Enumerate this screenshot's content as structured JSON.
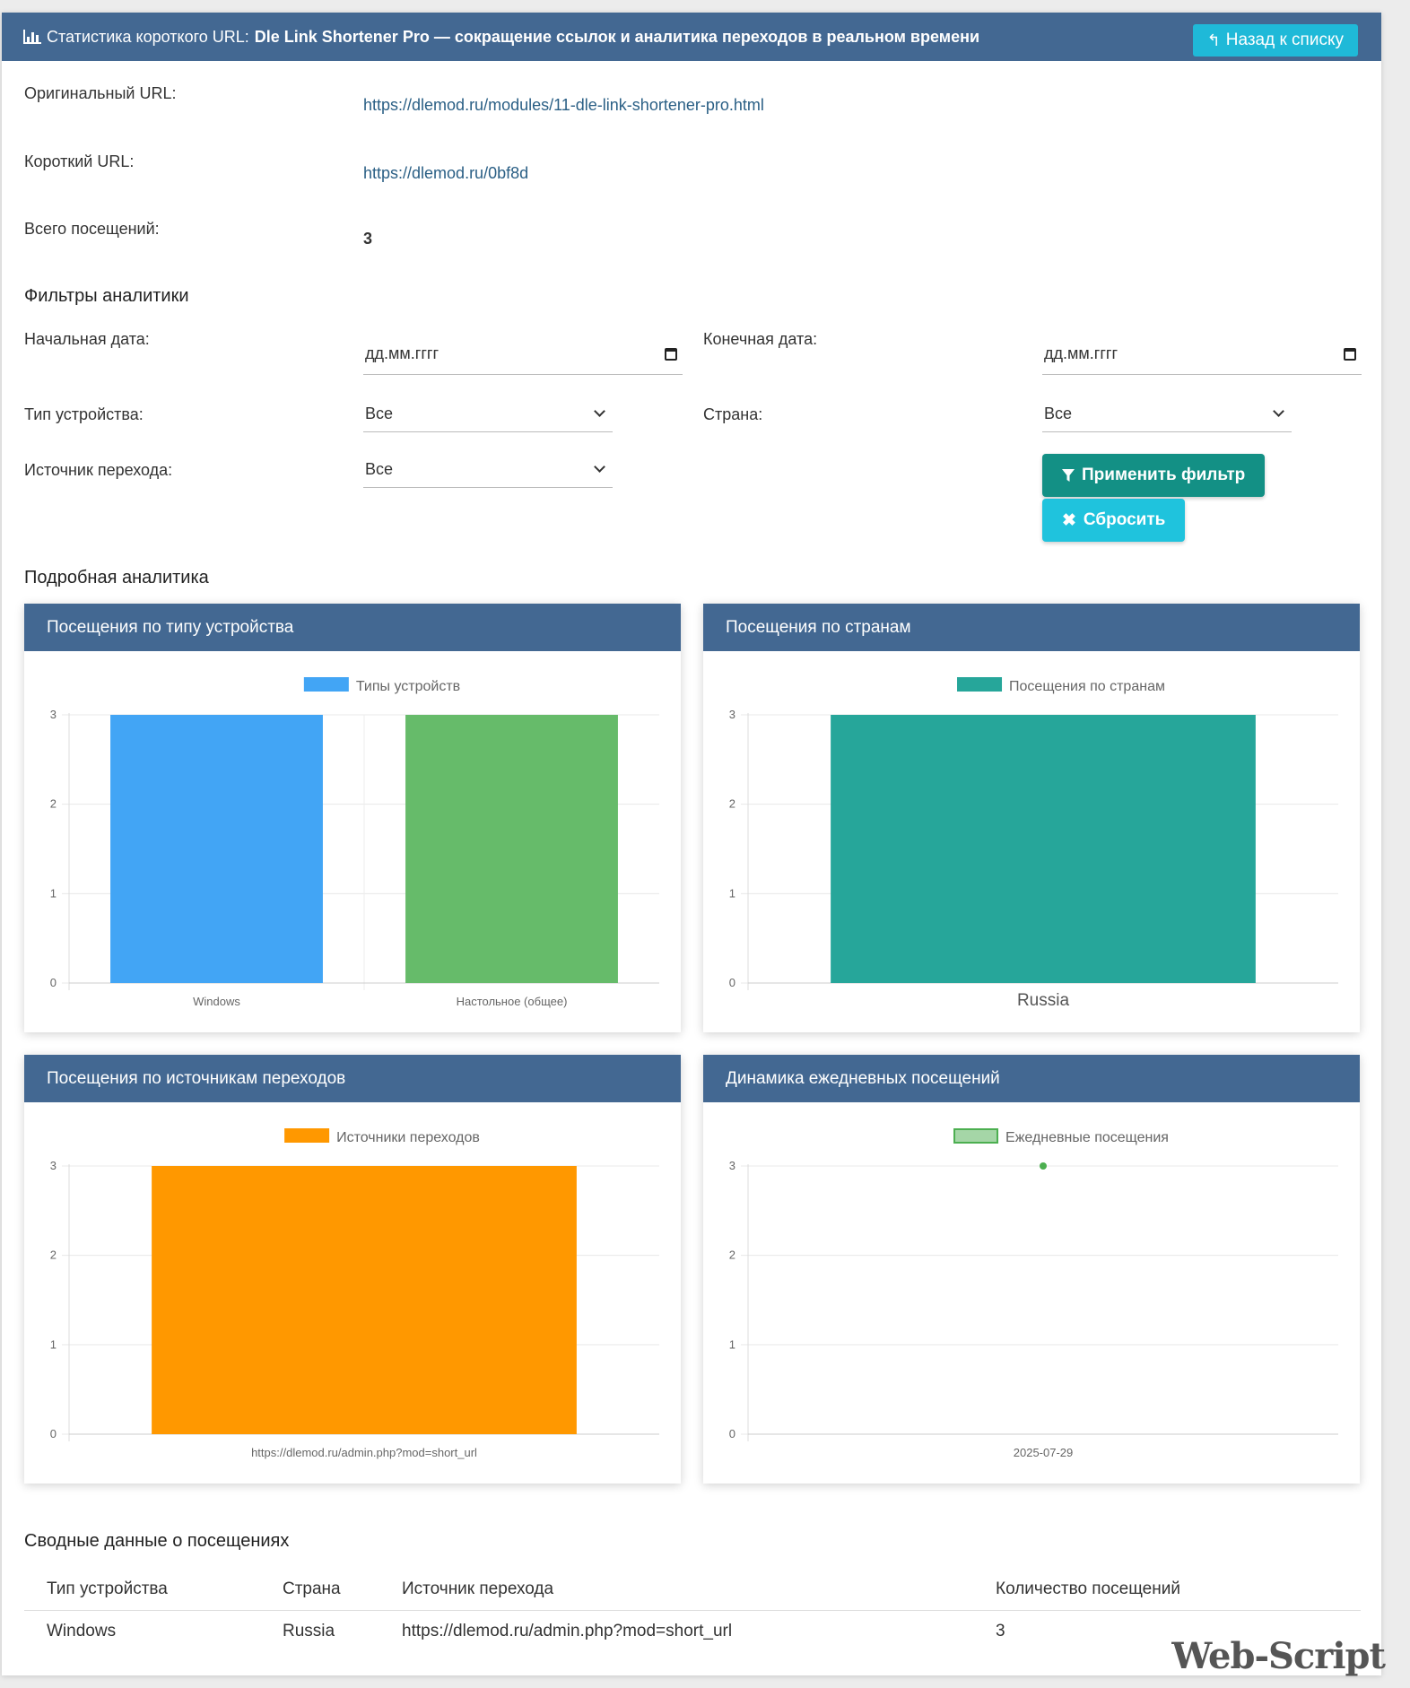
{
  "header": {
    "prefix": "Статистика короткого URL:",
    "title": "Dle Link Shortener Pro — сокращение ссылок и аналитика переходов в реальном времени",
    "back_label": "Назад к списку"
  },
  "info": {
    "original_url_label": "Оригинальный URL:",
    "original_url": "https://dlemod.ru/modules/11-dle-link-shortener-pro.html",
    "short_url_label": "Короткий URL:",
    "short_url": "https://dlemod.ru/0bf8d",
    "total_label": "Всего посещений:",
    "total": "3"
  },
  "filters": {
    "title": "Фильтры аналитики",
    "start_date_label": "Начальная дата:",
    "start_date_placeholder": "дд.мм.гггг",
    "end_date_label": "Конечная дата:",
    "end_date_placeholder": "дд.мм.гггг",
    "device_label": "Тип устройства:",
    "device_value": "Все",
    "country_label": "Страна:",
    "country_value": "Все",
    "source_label": "Источник перехода:",
    "source_value": "Все",
    "apply_label": "Применить фильтр",
    "reset_label": "Сбросить"
  },
  "analytics": {
    "title": "Подробная аналитика",
    "device_card_title": "Посещения по типу устройства",
    "country_card_title": "Посещения по странам",
    "source_card_title": "Посещения по источникам переходов",
    "daily_card_title": "Динамика ежедневных посещений"
  },
  "chart_data": [
    {
      "type": "bar",
      "categories": [
        "Windows",
        "Настольное (общее)"
      ],
      "series": [
        {
          "name": "Типы устройств",
          "values": [
            3,
            3
          ]
        }
      ],
      "colors": [
        "#42a5f5",
        "#66bb6a"
      ],
      "ylim": [
        0,
        3
      ],
      "yticks": [
        "0",
        "1",
        "2",
        "3"
      ],
      "grid": true,
      "legend": "top"
    },
    {
      "type": "bar",
      "categories": [
        "Russia"
      ],
      "series": [
        {
          "name": "Посещения по странам",
          "values": [
            3
          ]
        }
      ],
      "colors": [
        "#26a69a"
      ],
      "ylim": [
        0,
        3
      ],
      "yticks": [
        "0",
        "1",
        "2",
        "3"
      ],
      "grid": true,
      "legend": "top"
    },
    {
      "type": "bar",
      "categories": [
        "https://dlemod.ru/admin.php?mod=short_url"
      ],
      "series": [
        {
          "name": "Источники переходов",
          "values": [
            3
          ]
        }
      ],
      "colors": [
        "#ff9800"
      ],
      "ylim": [
        0,
        3
      ],
      "yticks": [
        "0",
        "1",
        "2",
        "3"
      ],
      "grid": true,
      "legend": "top"
    },
    {
      "type": "line",
      "categories": [
        "2025-07-29"
      ],
      "series": [
        {
          "name": "Ежедневные посещения",
          "values": [
            3
          ]
        }
      ],
      "colors": [
        "#4caf50"
      ],
      "ylim": [
        0,
        3
      ],
      "yticks": [
        "0",
        "1",
        "2",
        "3"
      ],
      "grid": true,
      "legend": "top"
    }
  ],
  "summary": {
    "title": "Сводные данные о посещениях",
    "columns": [
      "Тип устройства",
      "Страна",
      "Источник перехода",
      "Количество посещений"
    ],
    "rows": [
      [
        "Windows",
        "Russia",
        "https://dlemod.ru/admin.php?mod=short_url",
        "3"
      ]
    ]
  },
  "watermark": "Web-Script",
  "colors": {
    "header_bg": "#436892",
    "accent_teal": "#139085",
    "accent_cyan": "#1fc3dd",
    "link": "#2a5f85"
  }
}
